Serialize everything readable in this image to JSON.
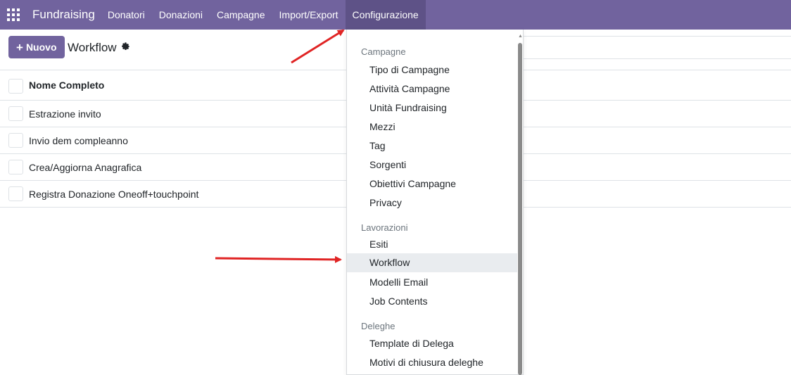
{
  "navbar": {
    "brand": "Fundraising",
    "items": [
      {
        "label": "Donatori"
      },
      {
        "label": "Donazioni"
      },
      {
        "label": "Campagne"
      },
      {
        "label": "Import/Export"
      },
      {
        "label": "Configurazione"
      }
    ],
    "active": "Configurazione",
    "color": "#71639e"
  },
  "control": {
    "new_button": "Nuovo",
    "breadcrumb": "Workflow"
  },
  "list": {
    "header": "Nome Completo",
    "rows": [
      "Estrazione invito",
      "Invio dem compleanno",
      "Crea/Aggiorna Anagrafica",
      "Registra Donazione Oneoff+touchpoint"
    ]
  },
  "dropdown": {
    "sections": [
      {
        "title": "Campagne",
        "items": [
          "Tipo di Campagne",
          "Attività Campagne",
          "Unità Fundraising",
          "Mezzi",
          "Tag",
          "Sorgenti",
          "Obiettivi Campagne",
          "Privacy"
        ]
      },
      {
        "title": "Lavorazioni",
        "items": [
          "Esiti",
          "Workflow",
          "Modelli Email",
          "Job Contents"
        ]
      },
      {
        "title": "Deleghe",
        "items": [
          "Template di Delega",
          "Motivi di chiusura deleghe"
        ]
      }
    ],
    "highlighted": "Workflow"
  },
  "annotation_color": "#e02424"
}
